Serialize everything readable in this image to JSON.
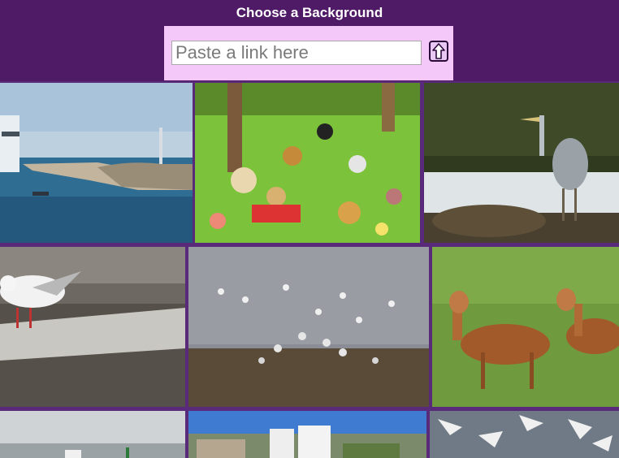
{
  "header": {
    "title": "Choose a Background",
    "link_placeholder": "Paste a link here",
    "link_value": ""
  },
  "submit_icon": "upload-arrow-icon",
  "gallery": {
    "row1": [
      "harbor-breakwater-photo",
      "cartoon-dogs-park-illustration",
      "heron-on-rock-photo"
    ],
    "row2": [
      "seagull-on-wall-photo",
      "seagulls-on-shore-photo",
      "deer-in-grass-photo"
    ],
    "row3": [
      "harbor-town-photo",
      "coastal-hotel-photo",
      "flying-seagulls-photo"
    ]
  },
  "colors": {
    "header_bg": "#4f1a66",
    "bar_bg": "#f4c8f9",
    "title_text": "#ffffff"
  }
}
